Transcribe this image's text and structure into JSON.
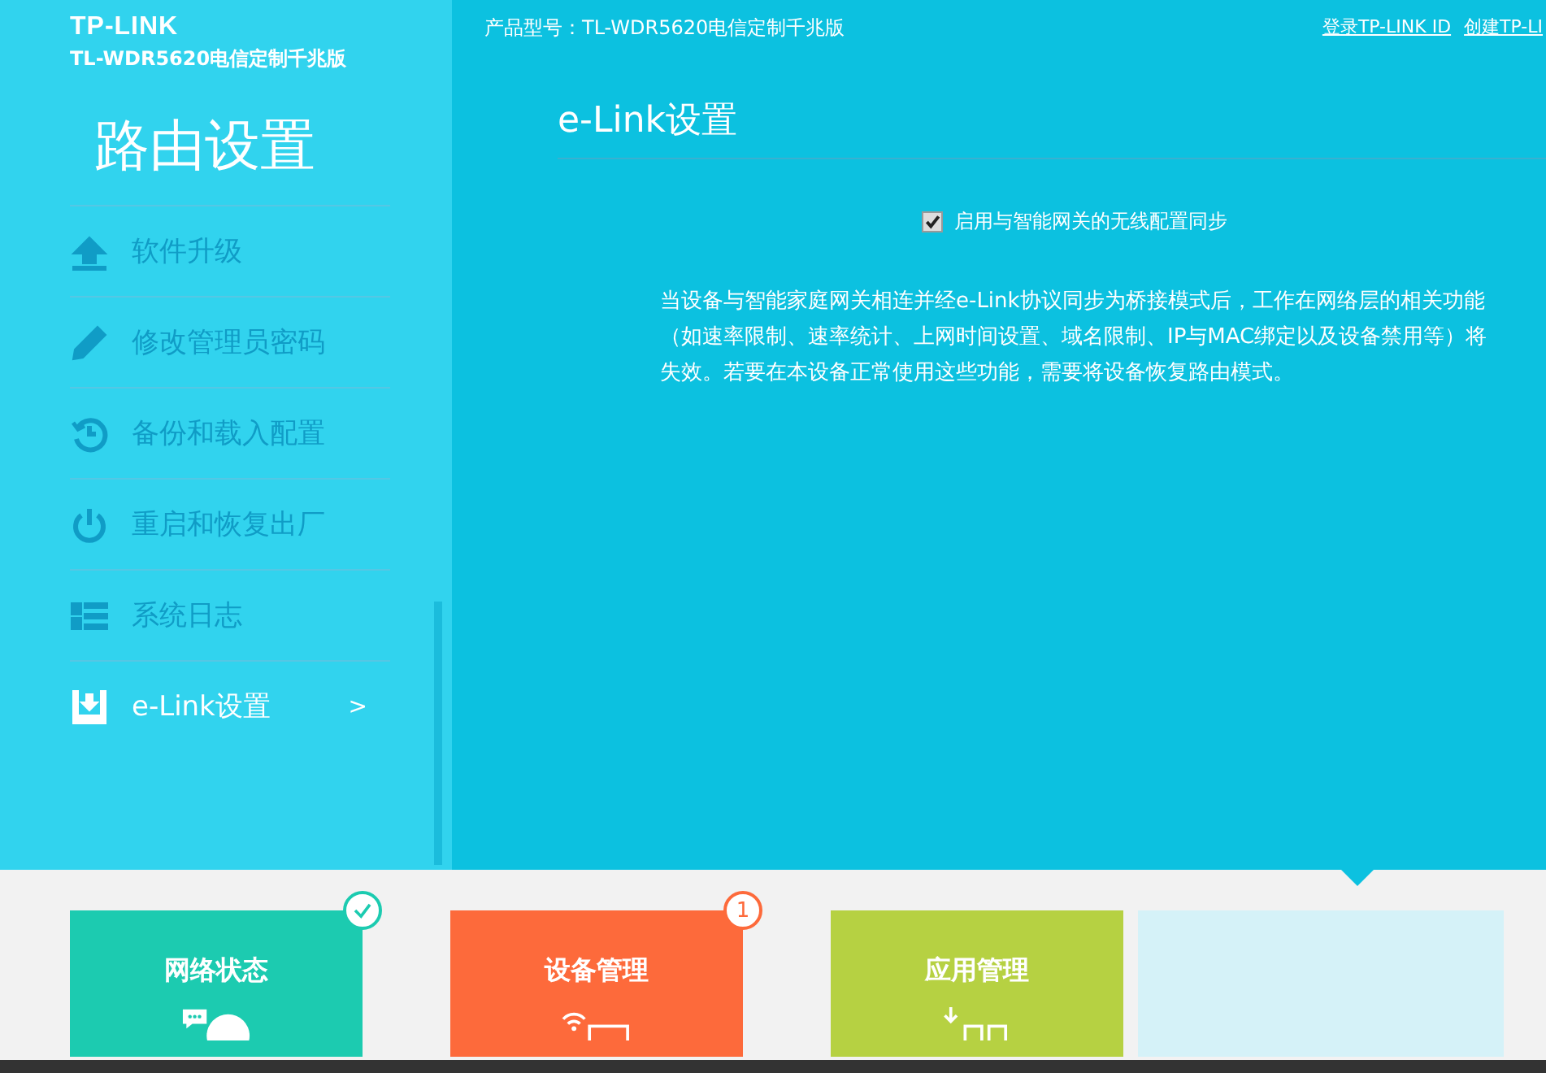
{
  "header": {
    "brand": "TP-LINK",
    "model": "TL-WDR5620电信定制千兆版",
    "product": "产品型号：TL-WDR5620电信定制千兆版",
    "links": [
      "登录TP-LINK ID",
      "创建TP-LI"
    ]
  },
  "sidebar": {
    "title": "路由设置",
    "items": [
      {
        "label": "软件升级",
        "selected": false
      },
      {
        "label": "修改管理员密码",
        "selected": false
      },
      {
        "label": "备份和载入配置",
        "selected": false
      },
      {
        "label": "重启和恢复出厂",
        "selected": false
      },
      {
        "label": "系统日志",
        "selected": false
      },
      {
        "label": "e-Link设置",
        "selected": true,
        "arrow": ">"
      }
    ]
  },
  "content": {
    "title": "e-Link设置",
    "sync_option": {
      "label": "启用与智能网关的无线配置同步",
      "checked": true
    },
    "description": "当设备与智能家庭网关相连并经e-Link协议同步为桥接模式后，工作在网络层的相关功能（如速率限制、速率统计、上网时间设置、域名限制、IP与MAC绑定以及设备禁用等）将失效。若要在本设备正常使用这些功能，需要将设备恢复路由模式。"
  },
  "tiles": [
    {
      "label": "网络状态",
      "color": "#1ccbb0",
      "badge": {
        "kind": "check"
      },
      "selected": false
    },
    {
      "label": "设备管理",
      "color": "#fd6a3b",
      "badge": {
        "kind": "count",
        "text": "1"
      },
      "selected": false
    },
    {
      "label": "应用管理",
      "color": "#b6d142",
      "selected": false
    },
    {
      "color": "#d5f2f8",
      "selected": true
    }
  ]
}
